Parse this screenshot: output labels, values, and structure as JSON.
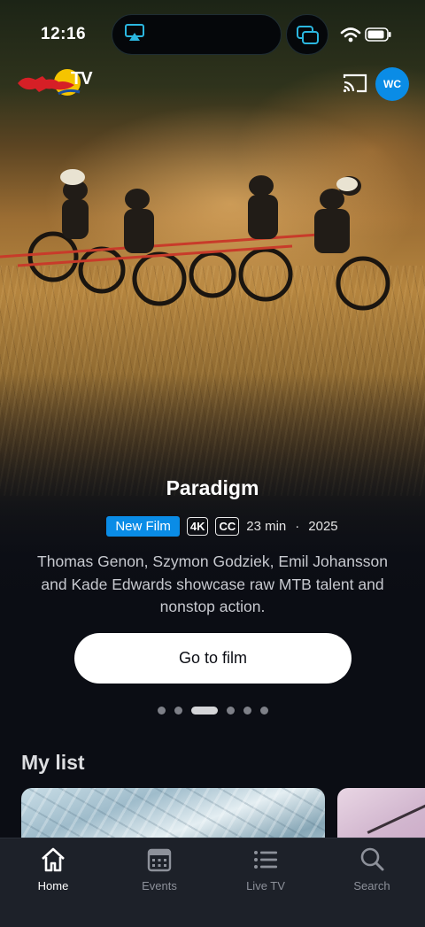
{
  "status_bar": {
    "time": "12:16"
  },
  "header": {
    "logo_text": "TV",
    "avatar_initials": "WC"
  },
  "hero": {
    "title": "Paradigm",
    "badge": "New Film",
    "quality": "4K",
    "captions": "CC",
    "duration": "23 min",
    "separator": "·",
    "year": "2025",
    "description": "Thomas Genon, Szymon Godziek, Emil Johansson and Kade Edwards showcase raw MTB talent and nonstop action.",
    "cta_label": "Go to film",
    "carousel": {
      "count": 6,
      "active_index": 2
    }
  },
  "my_list": {
    "title": "My list"
  },
  "tab_bar": {
    "items": [
      {
        "label": "Home",
        "icon": "home-icon",
        "active": true
      },
      {
        "label": "Events",
        "icon": "calendar-icon",
        "active": false
      },
      {
        "label": "Live TV",
        "icon": "list-icon",
        "active": false
      },
      {
        "label": "Search",
        "icon": "search-icon",
        "active": false
      }
    ]
  },
  "colors": {
    "accent": "#0a8ce6",
    "background": "#0b0d14",
    "tab_bar": "#1d2129"
  }
}
